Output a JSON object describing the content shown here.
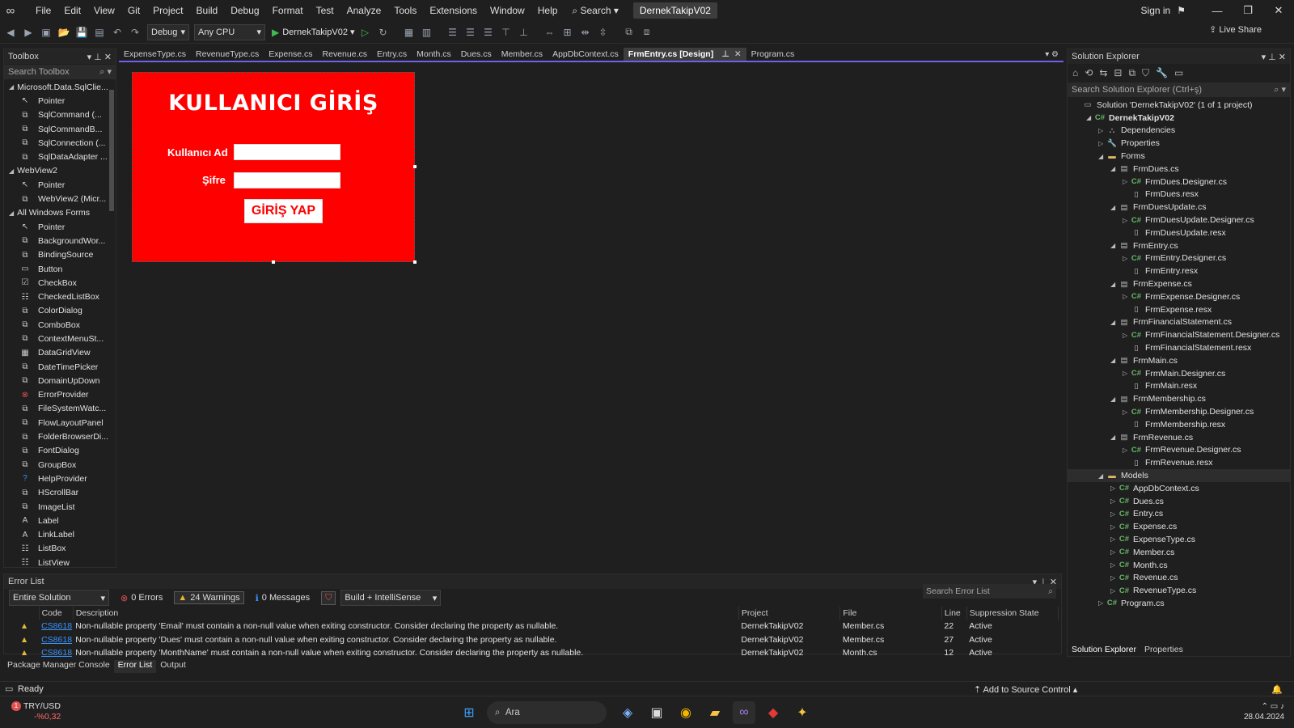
{
  "menubar": {
    "items": [
      "File",
      "Edit",
      "View",
      "Git",
      "Project",
      "Build",
      "Debug",
      "Format",
      "Test",
      "Analyze",
      "Tools",
      "Extensions",
      "Window",
      "Help"
    ],
    "search": "Search",
    "project": "DernekTakipV02",
    "sign_in": "Sign in"
  },
  "toolbar": {
    "config": "Debug",
    "platform": "Any CPU",
    "run_target": "DernekTakipV02",
    "live_share": "Live Share"
  },
  "toolbox": {
    "title": "Toolbox",
    "search_placeholder": "Search Toolbox",
    "items": [
      {
        "type": "group",
        "label": "Microsoft.Data.SqlClie..."
      },
      {
        "type": "tool",
        "label": "Pointer",
        "icon": "pointer-icon"
      },
      {
        "type": "tool",
        "label": "SqlCommand (...",
        "icon": "component-icon"
      },
      {
        "type": "tool",
        "label": "SqlCommandB...",
        "icon": "component-icon"
      },
      {
        "type": "tool",
        "label": "SqlConnection (...",
        "icon": "component-icon"
      },
      {
        "type": "tool",
        "label": "SqlDataAdapter ...",
        "icon": "component-icon"
      },
      {
        "type": "group",
        "label": "WebView2"
      },
      {
        "type": "tool",
        "label": "Pointer",
        "icon": "pointer-icon"
      },
      {
        "type": "tool",
        "label": "WebView2 (Micr...",
        "icon": "component-icon"
      },
      {
        "type": "group",
        "label": "All Windows Forms"
      },
      {
        "type": "tool",
        "label": "Pointer",
        "icon": "pointer-icon"
      },
      {
        "type": "tool",
        "label": "BackgroundWor...",
        "icon": "component-icon"
      },
      {
        "type": "tool",
        "label": "BindingSource",
        "icon": "component-icon"
      },
      {
        "type": "tool",
        "label": "Button",
        "icon": "button-icon"
      },
      {
        "type": "tool",
        "label": "CheckBox",
        "icon": "checkbox-icon"
      },
      {
        "type": "tool",
        "label": "CheckedListBox",
        "icon": "list-icon"
      },
      {
        "type": "tool",
        "label": "ColorDialog",
        "icon": "component-icon"
      },
      {
        "type": "tool",
        "label": "ComboBox",
        "icon": "component-icon"
      },
      {
        "type": "tool",
        "label": "ContextMenuSt...",
        "icon": "component-icon"
      },
      {
        "type": "tool",
        "label": "DataGridView",
        "icon": "grid-icon"
      },
      {
        "type": "tool",
        "label": "DateTimePicker",
        "icon": "component-icon"
      },
      {
        "type": "tool",
        "label": "DomainUpDown",
        "icon": "component-icon"
      },
      {
        "type": "tool",
        "label": "ErrorProvider",
        "icon": "error-icon"
      },
      {
        "type": "tool",
        "label": "FileSystemWatc...",
        "icon": "component-icon"
      },
      {
        "type": "tool",
        "label": "FlowLayoutPanel",
        "icon": "component-icon"
      },
      {
        "type": "tool",
        "label": "FolderBrowserDi...",
        "icon": "component-icon"
      },
      {
        "type": "tool",
        "label": "FontDialog",
        "icon": "component-icon"
      },
      {
        "type": "tool",
        "label": "GroupBox",
        "icon": "component-icon"
      },
      {
        "type": "tool",
        "label": "HelpProvider",
        "icon": "help-icon"
      },
      {
        "type": "tool",
        "label": "HScrollBar",
        "icon": "component-icon"
      },
      {
        "type": "tool",
        "label": "ImageList",
        "icon": "component-icon"
      },
      {
        "type": "tool",
        "label": "Label",
        "icon": "label-icon"
      },
      {
        "type": "tool",
        "label": "LinkLabel",
        "icon": "label-icon"
      },
      {
        "type": "tool",
        "label": "ListBox",
        "icon": "list-icon"
      },
      {
        "type": "tool",
        "label": "ListView",
        "icon": "list-icon"
      }
    ]
  },
  "tabs": [
    {
      "label": "ExpenseType.cs",
      "active": false
    },
    {
      "label": "RevenueType.cs",
      "active": false
    },
    {
      "label": "Expense.cs",
      "active": false
    },
    {
      "label": "Revenue.cs",
      "active": false
    },
    {
      "label": "Entry.cs",
      "active": false
    },
    {
      "label": "Month.cs",
      "active": false
    },
    {
      "label": "Dues.cs",
      "active": false
    },
    {
      "label": "Member.cs",
      "active": false
    },
    {
      "label": "AppDbContext.cs",
      "active": false
    },
    {
      "label": "FrmEntry.cs [Design]",
      "active": true
    },
    {
      "label": "Program.cs",
      "active": false
    }
  ],
  "form": {
    "title": "KULLANICI GİRİŞ",
    "username_label": "Kullanıcı Ad",
    "password_label": "Şifre",
    "login_button": "GİRİŞ YAP",
    "background": "#ff0000"
  },
  "errorlist": {
    "title": "Error List",
    "scope": "Entire Solution",
    "errors": "0 Errors",
    "warnings": "24 Warnings",
    "messages": "0 Messages",
    "build_filter": "Build + IntelliSense",
    "search_placeholder": "Search Error List",
    "columns": [
      "Code",
      "Description",
      "Project",
      "File",
      "Line",
      "Suppression State"
    ],
    "rows": [
      {
        "code": "CS8618",
        "desc": "Non-nullable property 'Email' must contain a non-null value when exiting constructor. Consider declaring the property as nullable.",
        "project": "DernekTakipV02",
        "file": "Member.cs",
        "line": "22",
        "state": "Active"
      },
      {
        "code": "CS8618",
        "desc": "Non-nullable property 'Dues' must contain a non-null value when exiting constructor. Consider declaring the property as nullable.",
        "project": "DernekTakipV02",
        "file": "Member.cs",
        "line": "27",
        "state": "Active"
      },
      {
        "code": "CS8618",
        "desc": "Non-nullable property 'MonthName' must contain a non-null value when exiting constructor. Consider declaring the property as nullable.",
        "project": "DernekTakipV02",
        "file": "Month.cs",
        "line": "12",
        "state": "Active"
      }
    ]
  },
  "bottom_tabs": [
    {
      "label": "Package Manager Console",
      "active": false
    },
    {
      "label": "Error List",
      "active": true
    },
    {
      "label": "Output",
      "active": false
    }
  ],
  "solution": {
    "title": "Solution Explorer",
    "search_placeholder": "Search Solution Explorer (Ctrl+ş)",
    "tree": [
      {
        "depth": 0,
        "label": "Solution 'DernekTakipV02' (1 of 1 project)",
        "icon": "solution",
        "tri": "",
        "bold": false
      },
      {
        "depth": 1,
        "label": "DernekTakipV02",
        "icon": "cs",
        "tri": "open",
        "bold": true
      },
      {
        "depth": 2,
        "label": "Dependencies",
        "icon": "deps",
        "tri": "closed"
      },
      {
        "depth": 2,
        "label": "Properties",
        "icon": "props",
        "tri": "closed"
      },
      {
        "depth": 2,
        "label": "Forms",
        "icon": "folder",
        "tri": "open"
      },
      {
        "depth": 3,
        "label": "FrmDues.cs",
        "icon": "form",
        "tri": "open"
      },
      {
        "depth": 4,
        "label": "FrmDues.Designer.cs",
        "icon": "cs",
        "tri": "closed"
      },
      {
        "depth": 4,
        "label": "FrmDues.resx",
        "icon": "resx",
        "tri": ""
      },
      {
        "depth": 3,
        "label": "FrmDuesUpdate.cs",
        "icon": "form",
        "tri": "open"
      },
      {
        "depth": 4,
        "label": "FrmDuesUpdate.Designer.cs",
        "icon": "cs",
        "tri": "closed"
      },
      {
        "depth": 4,
        "label": "FrmDuesUpdate.resx",
        "icon": "resx",
        "tri": ""
      },
      {
        "depth": 3,
        "label": "FrmEntry.cs",
        "icon": "form",
        "tri": "open"
      },
      {
        "depth": 4,
        "label": "FrmEntry.Designer.cs",
        "icon": "cs",
        "tri": "closed"
      },
      {
        "depth": 4,
        "label": "FrmEntry.resx",
        "icon": "resx",
        "tri": ""
      },
      {
        "depth": 3,
        "label": "FrmExpense.cs",
        "icon": "form",
        "tri": "open"
      },
      {
        "depth": 4,
        "label": "FrmExpense.Designer.cs",
        "icon": "cs",
        "tri": "closed"
      },
      {
        "depth": 4,
        "label": "FrmExpense.resx",
        "icon": "resx",
        "tri": ""
      },
      {
        "depth": 3,
        "label": "FrmFinancialStatement.cs",
        "icon": "form",
        "tri": "open"
      },
      {
        "depth": 4,
        "label": "FrmFinancialStatement.Designer.cs",
        "icon": "cs",
        "tri": "closed"
      },
      {
        "depth": 4,
        "label": "FrmFinancialStatement.resx",
        "icon": "resx",
        "tri": ""
      },
      {
        "depth": 3,
        "label": "FrmMain.cs",
        "icon": "form",
        "tri": "open"
      },
      {
        "depth": 4,
        "label": "FrmMain.Designer.cs",
        "icon": "cs",
        "tri": "closed"
      },
      {
        "depth": 4,
        "label": "FrmMain.resx",
        "icon": "resx",
        "tri": ""
      },
      {
        "depth": 3,
        "label": "FrmMembership.cs",
        "icon": "form",
        "tri": "open"
      },
      {
        "depth": 4,
        "label": "FrmMembership.Designer.cs",
        "icon": "cs",
        "tri": "closed"
      },
      {
        "depth": 4,
        "label": "FrmMembership.resx",
        "icon": "resx",
        "tri": ""
      },
      {
        "depth": 3,
        "label": "FrmRevenue.cs",
        "icon": "form",
        "tri": "open"
      },
      {
        "depth": 4,
        "label": "FrmRevenue.Designer.cs",
        "icon": "cs",
        "tri": "closed"
      },
      {
        "depth": 4,
        "label": "FrmRevenue.resx",
        "icon": "resx",
        "tri": ""
      },
      {
        "depth": 2,
        "label": "Models",
        "icon": "folder",
        "tri": "open",
        "selected": true
      },
      {
        "depth": 3,
        "label": "AppDbContext.cs",
        "icon": "cs",
        "tri": "closed"
      },
      {
        "depth": 3,
        "label": "Dues.cs",
        "icon": "cs",
        "tri": "closed"
      },
      {
        "depth": 3,
        "label": "Entry.cs",
        "icon": "cs",
        "tri": "closed"
      },
      {
        "depth": 3,
        "label": "Expense.cs",
        "icon": "cs",
        "tri": "closed"
      },
      {
        "depth": 3,
        "label": "ExpenseType.cs",
        "icon": "cs",
        "tri": "closed"
      },
      {
        "depth": 3,
        "label": "Member.cs",
        "icon": "cs",
        "tri": "closed"
      },
      {
        "depth": 3,
        "label": "Month.cs",
        "icon": "cs",
        "tri": "closed"
      },
      {
        "depth": 3,
        "label": "Revenue.cs",
        "icon": "cs",
        "tri": "closed"
      },
      {
        "depth": 3,
        "label": "RevenueType.cs",
        "icon": "cs",
        "tri": "closed"
      },
      {
        "depth": 2,
        "label": "Program.cs",
        "icon": "cs",
        "tri": "closed"
      }
    ],
    "bottom_tabs": [
      {
        "label": "Solution Explorer",
        "active": true
      },
      {
        "label": "Properties",
        "active": false
      }
    ]
  },
  "statusbar": {
    "ready": "Ready",
    "source_control": "Add to Source Control"
  },
  "taskbar": {
    "currency": "TRY/USD",
    "change": "-%0,32",
    "badge": "1",
    "search": "Ara",
    "date": "28.04.2024"
  }
}
